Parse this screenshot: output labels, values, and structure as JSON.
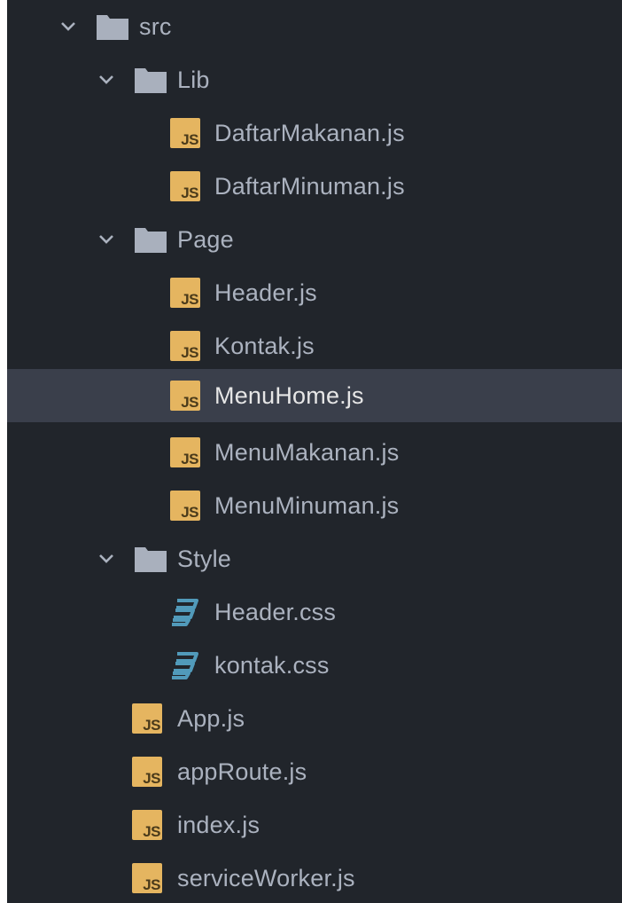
{
  "colors": {
    "background": "#21252b",
    "selected_row": "#3a3f4b",
    "text": "#abb2bf",
    "js_icon": "#e5b560",
    "css_icon": "#519aba",
    "folder_icon": "#a9b0bd"
  },
  "tree": [
    {
      "label": "src",
      "type": "folder",
      "icon": "folder-icon",
      "expanded": true
    },
    {
      "label": "Lib",
      "type": "folder",
      "icon": "folder-icon",
      "expanded": true
    },
    {
      "label": "DaftarMakanan.js",
      "type": "file",
      "icon": "js-file-icon"
    },
    {
      "label": "DaftarMinuman.js",
      "type": "file",
      "icon": "js-file-icon"
    },
    {
      "label": "Page",
      "type": "folder",
      "icon": "folder-icon",
      "expanded": true
    },
    {
      "label": "Header.js",
      "type": "file",
      "icon": "js-file-icon"
    },
    {
      "label": "Kontak.js",
      "type": "file",
      "icon": "js-file-icon"
    },
    {
      "label": "MenuHome.js",
      "type": "file",
      "icon": "js-file-icon",
      "selected": true
    },
    {
      "label": "MenuMakanan.js",
      "type": "file",
      "icon": "js-file-icon"
    },
    {
      "label": "MenuMinuman.js",
      "type": "file",
      "icon": "js-file-icon"
    },
    {
      "label": "Style",
      "type": "folder",
      "icon": "folder-icon",
      "expanded": true
    },
    {
      "label": "Header.css",
      "type": "file",
      "icon": "css-file-icon"
    },
    {
      "label": "kontak.css",
      "type": "file",
      "icon": "css-file-icon"
    },
    {
      "label": "App.js",
      "type": "file",
      "icon": "js-file-icon"
    },
    {
      "label": "appRoute.js",
      "type": "file",
      "icon": "js-file-icon"
    },
    {
      "label": "index.js",
      "type": "file",
      "icon": "js-file-icon"
    },
    {
      "label": "serviceWorker.js",
      "type": "file",
      "icon": "js-file-icon"
    }
  ],
  "js_badge": "JS"
}
